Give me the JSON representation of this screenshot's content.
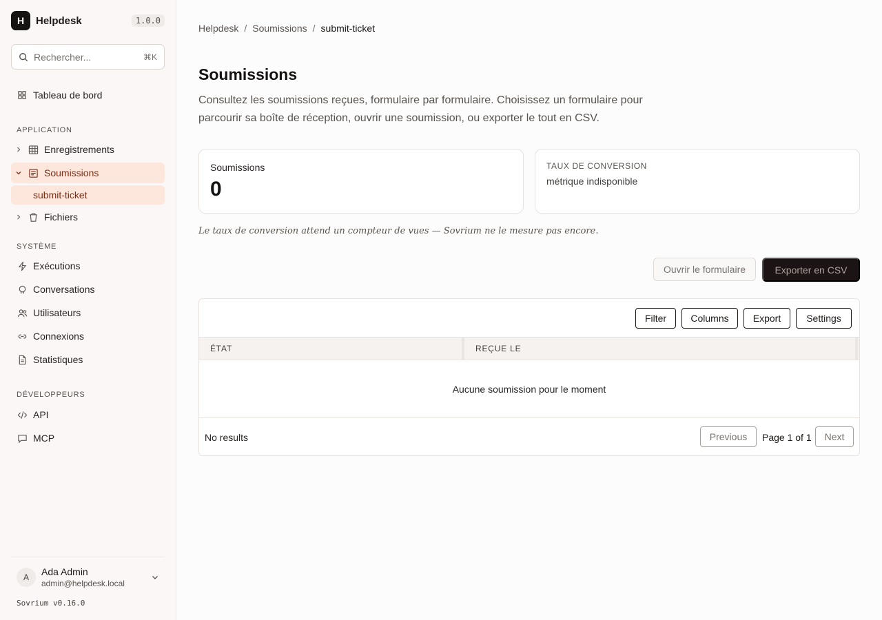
{
  "app": {
    "name": "Helpdesk",
    "logo_letter": "H",
    "version": "1.0.0"
  },
  "search": {
    "placeholder": "Rechercher...",
    "shortcut": "⌘K"
  },
  "sidebar": {
    "dashboard": {
      "label": "Tableau de bord",
      "icon": "grid-icon"
    },
    "sections": [
      {
        "title": "APPLICATION",
        "items": [
          {
            "label": "Enregistrements",
            "icon": "table-icon"
          },
          {
            "label": "Soumissions",
            "icon": "form-icon",
            "active": true,
            "children": [
              {
                "label": "submit-ticket",
                "active": true
              }
            ]
          },
          {
            "label": "Fichiers",
            "icon": "bucket-icon"
          }
        ]
      },
      {
        "title": "SYSTÈME",
        "items": [
          {
            "label": "Exécutions",
            "icon": "bolt-icon"
          },
          {
            "label": "Conversations",
            "icon": "chat-bubble-icon"
          },
          {
            "label": "Utilisateurs",
            "icon": "users-icon"
          },
          {
            "label": "Connexions",
            "icon": "link-icon"
          },
          {
            "label": "Statistiques",
            "icon": "document-icon"
          }
        ]
      },
      {
        "title": "DÉVELOPPEURS",
        "items": [
          {
            "label": "API",
            "icon": "code-icon"
          },
          {
            "label": "MCP",
            "icon": "message-icon"
          }
        ]
      }
    ],
    "user": {
      "initial": "A",
      "name": "Ada Admin",
      "email": "admin@helpdesk.local"
    },
    "footer": "Sovrium v0.16.0"
  },
  "breadcrumb": [
    "Helpdesk",
    "Soumissions",
    "submit-ticket"
  ],
  "page": {
    "title": "Soumissions",
    "description": "Consultez les soumissions reçues, formulaire par formulaire. Choisissez un formulaire pour parcourir sa boîte de réception, ouvrir une soumission, ou exporter le tout en CSV."
  },
  "stats": {
    "submissions": {
      "label": "Soumissions",
      "value": "0"
    },
    "conversion": {
      "label": "TAUX DE CONVERSION",
      "value": "métrique indisponible"
    }
  },
  "note": "Le taux de conversion attend un compteur de vues — Sovrium ne le mesure pas encore.",
  "actions": {
    "open_form": "Ouvrir le formulaire",
    "export_csv": "Exporter en CSV"
  },
  "table": {
    "toolbar": [
      "Filter",
      "Columns",
      "Export",
      "Settings"
    ],
    "columns": [
      "ÉTAT",
      "REÇUE LE"
    ],
    "empty_message": "Aucune soumission pour le moment",
    "footer": {
      "results": "No results",
      "previous": "Previous",
      "page_label": "Page 1 of 1",
      "next": "Next"
    }
  }
}
